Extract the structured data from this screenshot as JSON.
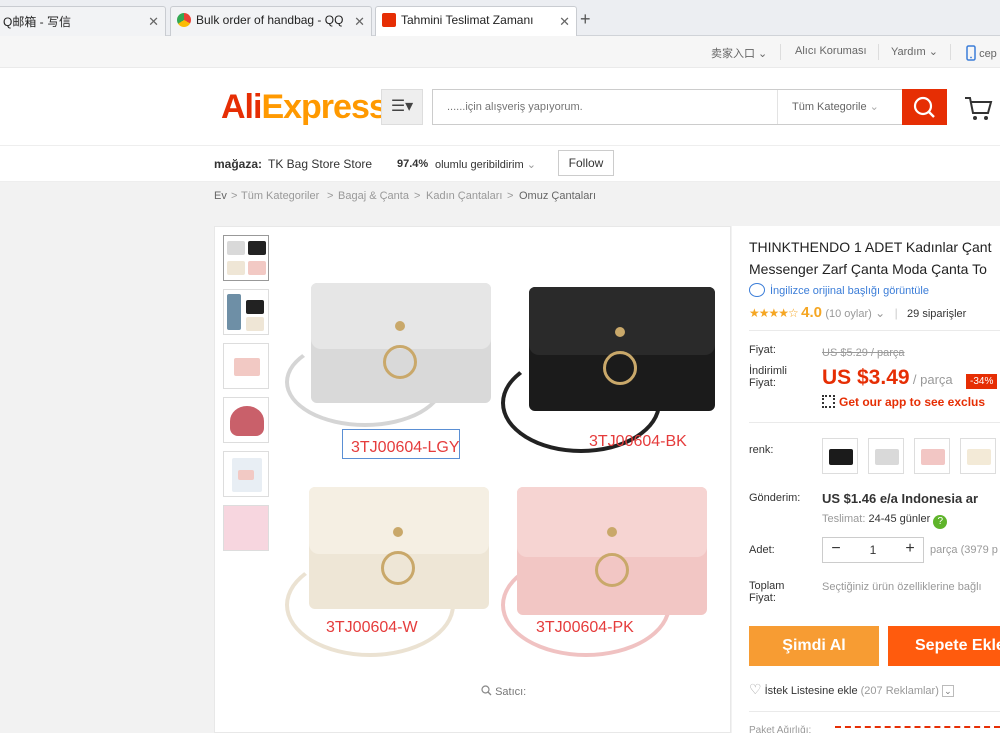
{
  "browser": {
    "tabs": [
      {
        "title": "Q邮箱 - 写信",
        "active": false
      },
      {
        "title": "Bulk order of handbag - QQ",
        "active": false
      },
      {
        "title": "Tahmini Teslimat Zamanı",
        "active": true
      }
    ],
    "new_tab": "+"
  },
  "utility": {
    "seller_entry": "卖家入口",
    "buyer_protection": "Alıcı Koruması",
    "help": "Yardım",
    "mobile": "cep"
  },
  "header": {
    "logo_part1": "Ali",
    "logo_part2": "Express",
    "search_placeholder": "......için alışveriş yapıyorum.",
    "category_select": "Tüm Kategorile",
    "colors": {
      "brand": "#e62e04",
      "accent": "#f90"
    }
  },
  "store": {
    "label": "mağaza:",
    "name": "TK Bag Store Store",
    "feedback_percent": "97.4%",
    "feedback_text": "olumlu geribildirim",
    "follow": "Follow"
  },
  "breadcrumb": [
    "Ev",
    ">",
    "Tüm Kategoriler",
    ">",
    "Bagaj & Çanta",
    ">",
    "Kadın Çantaları",
    ">",
    "Omuz Çantaları"
  ],
  "gallery": {
    "codes": [
      "3TJ00604-LGY",
      "3TJ00604-BK",
      "3TJ00604-W",
      "3TJ00604-PK"
    ],
    "seller_watermark": "Satıcı:"
  },
  "product": {
    "title_line1": "THINKTHENDO 1 ADET Kadınlar Çant",
    "title_line2": "Messenger Zarf Çanta Moda Çanta To",
    "translate_link": "İngilizce orijinal başlığı görüntüle",
    "rating": "4.0",
    "rating_count": "(10 oylar)",
    "orders": "29 siparişler",
    "price_label": "Fiyat:",
    "old_price": "US $5.29 / parça",
    "discount_label_1": "İndirimli",
    "discount_label_2": "Fiyat:",
    "price": "US $3.49",
    "price_unit": "/ parça",
    "discount": "-34%",
    "app_link": "Get our app to see exclus",
    "color_label": "renk:",
    "shipping_label": "Gönderim:",
    "shipping_value": "US $1.46 e/a",
    "shipping_dest": "Indonesia ar",
    "delivery_label": "Teslimat:",
    "delivery_value": "24-45 günler",
    "help_icon": "?",
    "qty_label": "Adet:",
    "qty_value": "1",
    "qty_stock": "parça (3979 p",
    "total_label_1": "Toplam",
    "total_label_2": "Fiyat:",
    "total_hint": "Seçtiğiniz ürün özelliklerine bağlı",
    "buy_now": "Şimdi Al",
    "add_to_cart": "Sepete Ekle",
    "wishlist": "İstek Listesine ekle",
    "wishlist_count": "(207 Reklamlar)",
    "package_weight": "Paket Ağırlığı:"
  }
}
